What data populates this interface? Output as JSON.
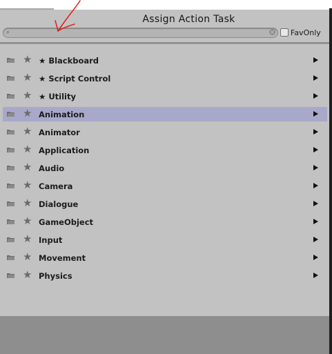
{
  "window": {
    "title": "Assign Action Task"
  },
  "search": {
    "value": "",
    "favonly_label": "FavOnly",
    "favonly_checked": false
  },
  "categories": [
    {
      "label": "★ Blackboard",
      "selected": false
    },
    {
      "label": "★ Script Control",
      "selected": false
    },
    {
      "label": "★ Utility",
      "selected": false
    },
    {
      "label": "Animation",
      "selected": true
    },
    {
      "label": "Animator",
      "selected": false
    },
    {
      "label": "Application",
      "selected": false
    },
    {
      "label": "Audio",
      "selected": false
    },
    {
      "label": "Camera",
      "selected": false
    },
    {
      "label": "Dialogue",
      "selected": false
    },
    {
      "label": "GameObject",
      "selected": false
    },
    {
      "label": "Input",
      "selected": false
    },
    {
      "label": "Movement",
      "selected": false
    },
    {
      "label": "Physics",
      "selected": false
    }
  ],
  "icons": {
    "row_folder": "folder-icon",
    "row_star": "star-icon",
    "row_arrow": "arrow-right-icon",
    "search": "search-icon",
    "clear": "clear-icon"
  },
  "colors": {
    "panel": "#c2c2c2",
    "selected_row": "#a8a8ca",
    "footer": "#8e8e8e",
    "annotation": "#e0241c"
  }
}
